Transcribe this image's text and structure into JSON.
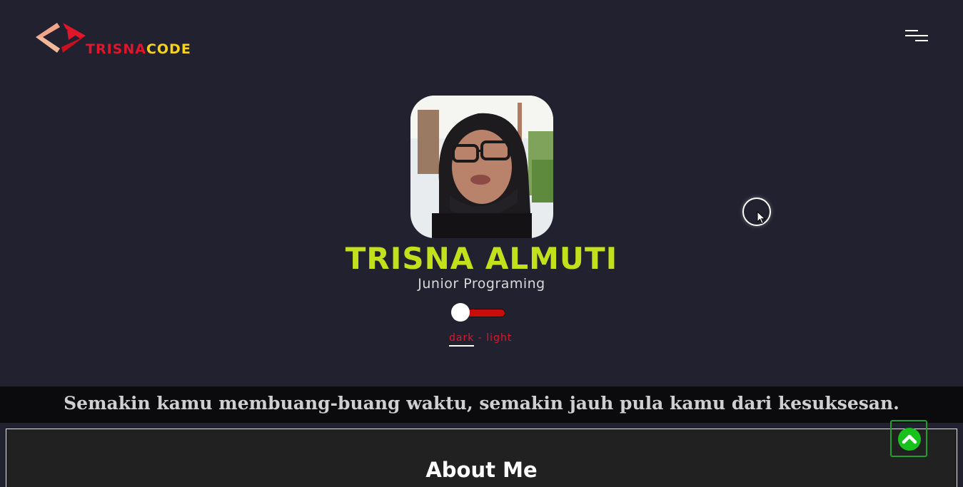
{
  "brand": {
    "name_part1": "TRISNA",
    "name_part2": "CODE",
    "colors": {
      "red": "#e0162b",
      "yellow": "#f7d21b",
      "peach": "#f3a58a"
    }
  },
  "header": {
    "menu_icon": "hamburger-menu-icon"
  },
  "profile": {
    "photo_icon": "profile-photo",
    "name": "TRISNA ALMUTI",
    "role": "Junior Programing",
    "name_color": "#c3e11a"
  },
  "theme_toggle": {
    "dark_label": "dark",
    "separator": " - ",
    "light_label": "light",
    "state": "dark",
    "track_color": "#c80d0d"
  },
  "quote": {
    "text": "Semakin kamu membuang-buang waktu, semakin jauh pula kamu dari kesuksesan."
  },
  "about": {
    "title": "About Me"
  },
  "back_to_top": {
    "icon": "chevron-up-icon",
    "color": "#18c21c"
  }
}
